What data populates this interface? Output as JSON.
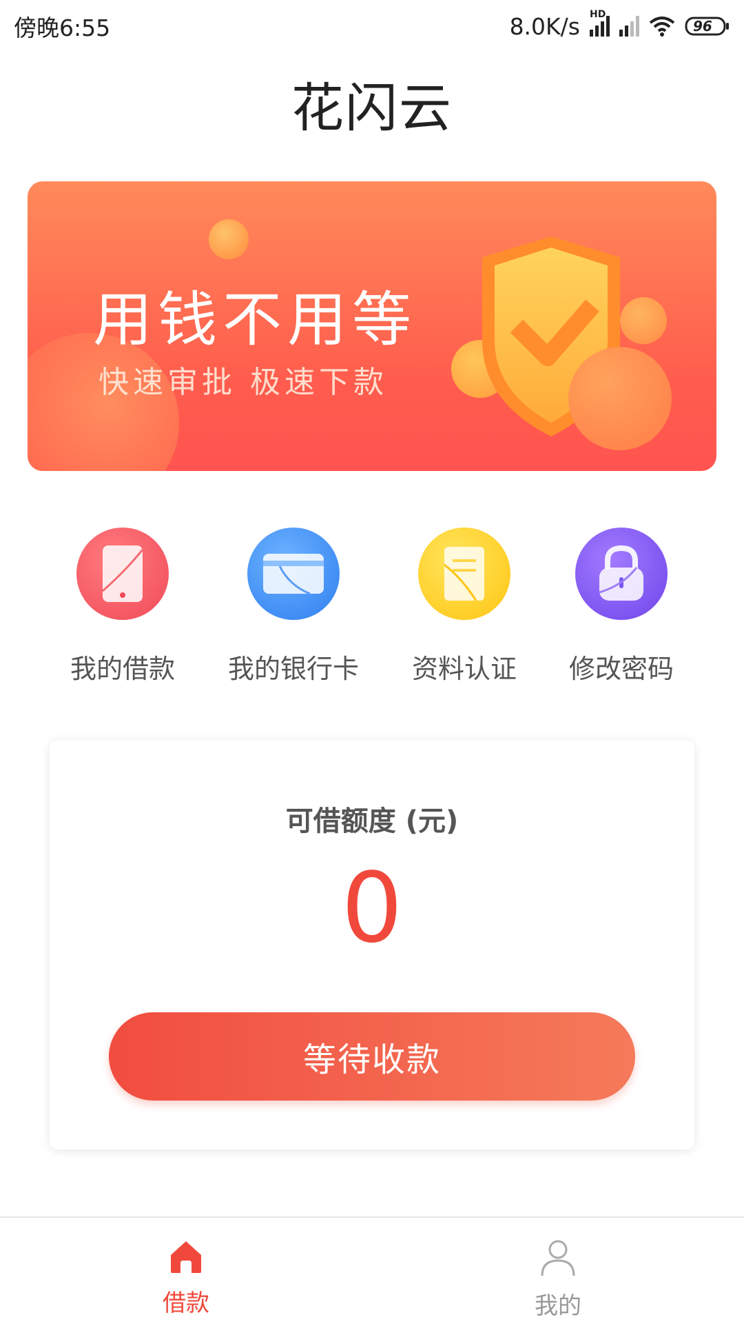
{
  "status_bar": {
    "time": "傍晚6:55",
    "network_speed": "8.0K/s",
    "hd_label": "HD",
    "battery": "96"
  },
  "header": {
    "title": "花闪云"
  },
  "banner": {
    "headline": "用钱不用等",
    "subline": "快速审批  极速下款"
  },
  "actions": [
    {
      "label": "我的借款",
      "icon": "phone-icon",
      "color": "#f4505c"
    },
    {
      "label": "我的银行卡",
      "icon": "bank-card-icon",
      "color": "#3f8ff7"
    },
    {
      "label": "资料认证",
      "icon": "document-icon",
      "color": "#ffd21f"
    },
    {
      "label": "修改密码",
      "icon": "lock-icon",
      "color": "#7b55f0"
    }
  ],
  "credit_card": {
    "title": "可借额度 (元)",
    "amount": "0",
    "button_label": "等待收款"
  },
  "bottom_nav": {
    "items": [
      {
        "label": "借款",
        "icon": "home-icon",
        "active": true
      },
      {
        "label": "我的",
        "icon": "user-icon",
        "active": false
      }
    ]
  },
  "colors": {
    "accent": "#f0493c",
    "banner_top": "#ff8a5a",
    "banner_bottom": "#ff5450"
  }
}
